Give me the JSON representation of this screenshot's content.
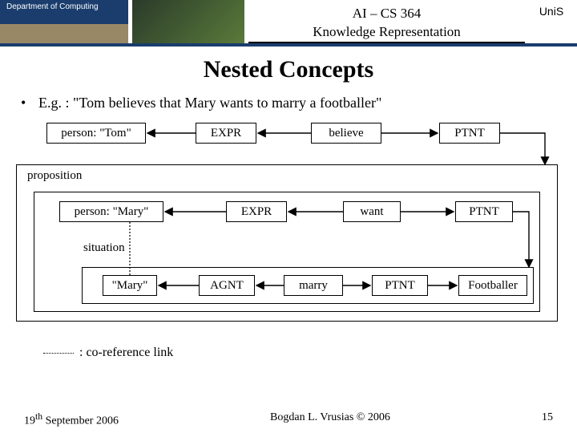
{
  "header": {
    "dept": "Department of Computing",
    "course": "AI – CS 364",
    "subtitle": "Knowledge Representation",
    "uni": "UniS"
  },
  "title": "Nested Concepts",
  "bullet": "E.g. : \"Tom believes that Mary wants to marry a footballer\"",
  "nodes": {
    "tom": "person: \"Tom\"",
    "expr1": "EXPR",
    "believe": "believe",
    "ptnt1": "PTNT",
    "prop": "proposition",
    "mary": "person: \"Mary\"",
    "expr2": "EXPR",
    "want": "want",
    "ptnt2": "PTNT",
    "sit": "situation",
    "mary2": "\"Mary\"",
    "agnt": "AGNT",
    "marry": "marry",
    "ptnt3": "PTNT",
    "foot": "Footballer"
  },
  "coref": " : co-reference link",
  "footer": {
    "date_pre": "19",
    "date_sup": "th",
    "date_post": " September 2006",
    "author": "Bogdan L. Vrusias © 2006",
    "page": "15"
  }
}
